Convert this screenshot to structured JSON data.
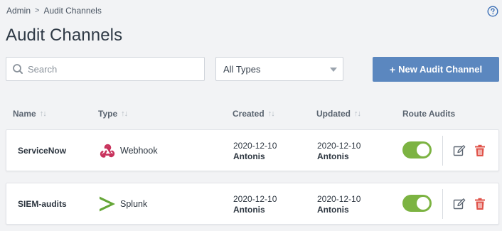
{
  "breadcrumb": {
    "items": [
      "Admin",
      "Audit Channels"
    ],
    "separator": ">"
  },
  "page_title": "Audit Channels",
  "search": {
    "placeholder": "Search",
    "value": ""
  },
  "type_filter": {
    "selected": "All Types"
  },
  "new_button": {
    "label": "New Audit Channel",
    "icon": "+"
  },
  "table": {
    "columns": [
      "Name",
      "Type",
      "Created",
      "Updated",
      "Route Audits"
    ],
    "rows": [
      {
        "name": "ServiceNow",
        "type": "Webhook",
        "type_icon": "webhook-icon",
        "created_date": "2020-12-10",
        "created_by": "Antonis",
        "updated_date": "2020-12-10",
        "updated_by": "Antonis",
        "route_audits": true
      },
      {
        "name": "SIEM-audits",
        "type": "Splunk",
        "type_icon": "splunk-icon",
        "created_date": "2020-12-10",
        "created_by": "Antonis",
        "updated_date": "2020-12-10",
        "updated_by": "Antonis",
        "route_audits": true
      }
    ]
  },
  "colors": {
    "accent": "#5b87bf",
    "toggle_on": "#7cb342",
    "delete": "#e0534a",
    "webhook": "#c8325c",
    "splunk": "#65a637"
  }
}
